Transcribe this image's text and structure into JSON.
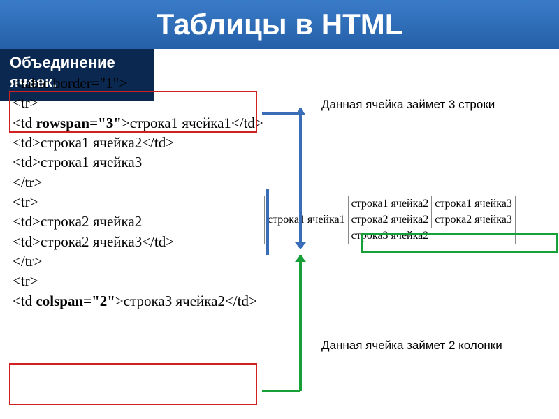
{
  "title": "Таблицы в HTML",
  "subtitle": "Объединение ячеек.",
  "code": {
    "l1": "<table border=\"1\">",
    "l2": "<tr>",
    "l3a": "<td ",
    "l3b": "rowspan=\"3\"",
    "l3c": ">строка1 ячейка1</td>",
    "l4": "<td>строка1 ячейка2</td>",
    "l5": "<td>строка1 ячейка3",
    "l6": "</tr>",
    "l7": "<tr>",
    "l8": "<td>строка2 ячейка2",
    "l9": "<td>строка2 ячейка3</td>",
    "l10": "</tr>",
    "l11": "<tr>",
    "l12a": "<td ",
    "l12b": "colspan=\"2\"",
    "l12c": ">строка3 ячейка2</td>"
  },
  "caption1": "Данная ячейка займет 3 строки",
  "caption2": "Данная ячейка займет 2 колонки",
  "table": {
    "r1c1": "строка1 ячейка1",
    "r1c2": "строка1 ячейка2",
    "r1c3": "строка1 ячейка3",
    "r2c2": "строка2 ячейка2",
    "r2c3": "строка2 ячейка3",
    "r3c2": "строка3 ячейка2"
  }
}
